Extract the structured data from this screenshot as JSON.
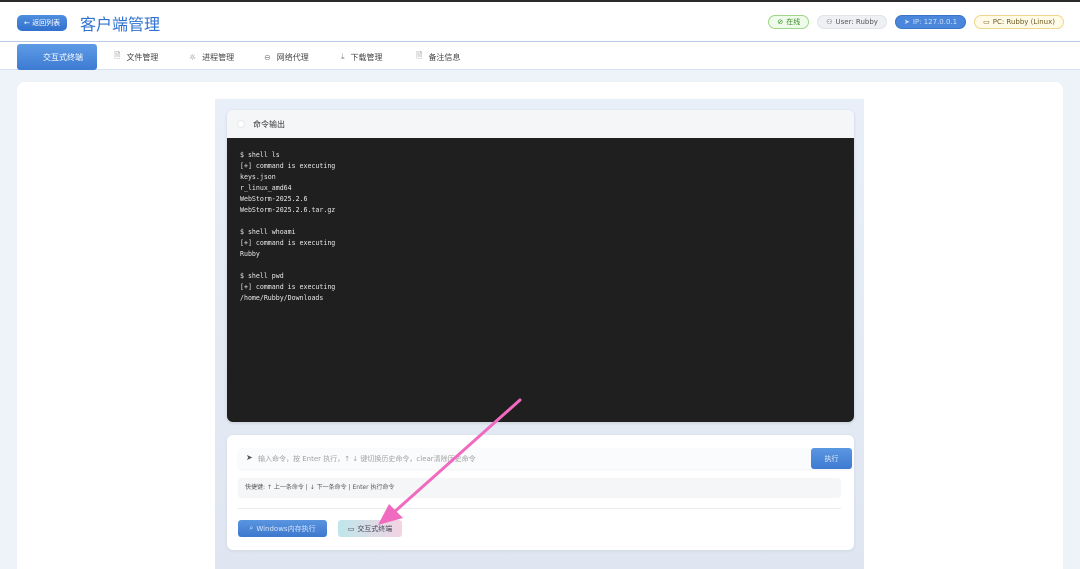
{
  "header": {
    "back_label": "← 返回列表",
    "title": "客户端管理",
    "badges": {
      "online": "在线",
      "user": "User: Rubby",
      "ip": "IP: 127.0.0.1",
      "pc": "PC: Rubby (Linux)"
    }
  },
  "tabs": [
    {
      "label": "交互式终端",
      "icon": "terminal-icon"
    },
    {
      "label": "文件管理",
      "icon": "file-icon"
    },
    {
      "label": "进程管理",
      "icon": "process-icon"
    },
    {
      "label": "网络代理",
      "icon": "link-icon"
    },
    {
      "label": "下载管理",
      "icon": "download-icon"
    },
    {
      "label": "备注信息",
      "icon": "note-icon"
    }
  ],
  "terminal": {
    "title": "命令输出",
    "output": "$ shell ls\n[+] command is executing\nkeys.json\nr_linux_amd64\nWebStorm-2025.2.6\nWebStorm-2025.2.6.tar.gz\n\n$ shell whoami\n[+] command is executing\nRubby\n\n$ shell pwd\n[+] command is executing\n/home/Rubby/Downloads"
  },
  "command": {
    "placeholder": "输入命令，按 Enter 执行，↑ ↓ 键切换历史命令，clear清除历史命令",
    "execute_label": "执行",
    "shortcut_hint": "快捷键: ↑ 上一条命令 | ↓ 下一条命令 | Enter 执行命令"
  },
  "mode_buttons": {
    "windows_label": "Windows内存执行",
    "terminal_label": "交互式终端"
  },
  "colors": {
    "accent": "#3d7bd3",
    "annotation_arrow": "#f06ac0"
  }
}
